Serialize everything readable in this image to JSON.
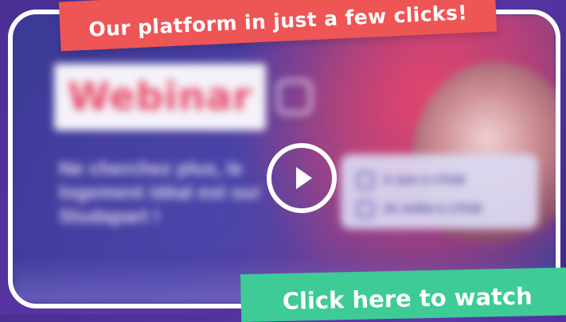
{
  "banner": {
    "text": "Our platform in just a few clicks!"
  },
  "video": {
    "thumbnail_title": "Webinar",
    "tagline": "Ne cherchez plus, le logement idéal est sur Studapart !",
    "dates": [
      {
        "label": "9 Juin à 17h30"
      },
      {
        "label": "20 Juillet à 17h30"
      }
    ]
  },
  "cta": {
    "text": "Click here to watch"
  },
  "colors": {
    "banner_red": "#ee5555",
    "cta_green": "#3ecb96",
    "background_purple": "#4a2f93",
    "webinar_pink": "#e84a6a"
  }
}
